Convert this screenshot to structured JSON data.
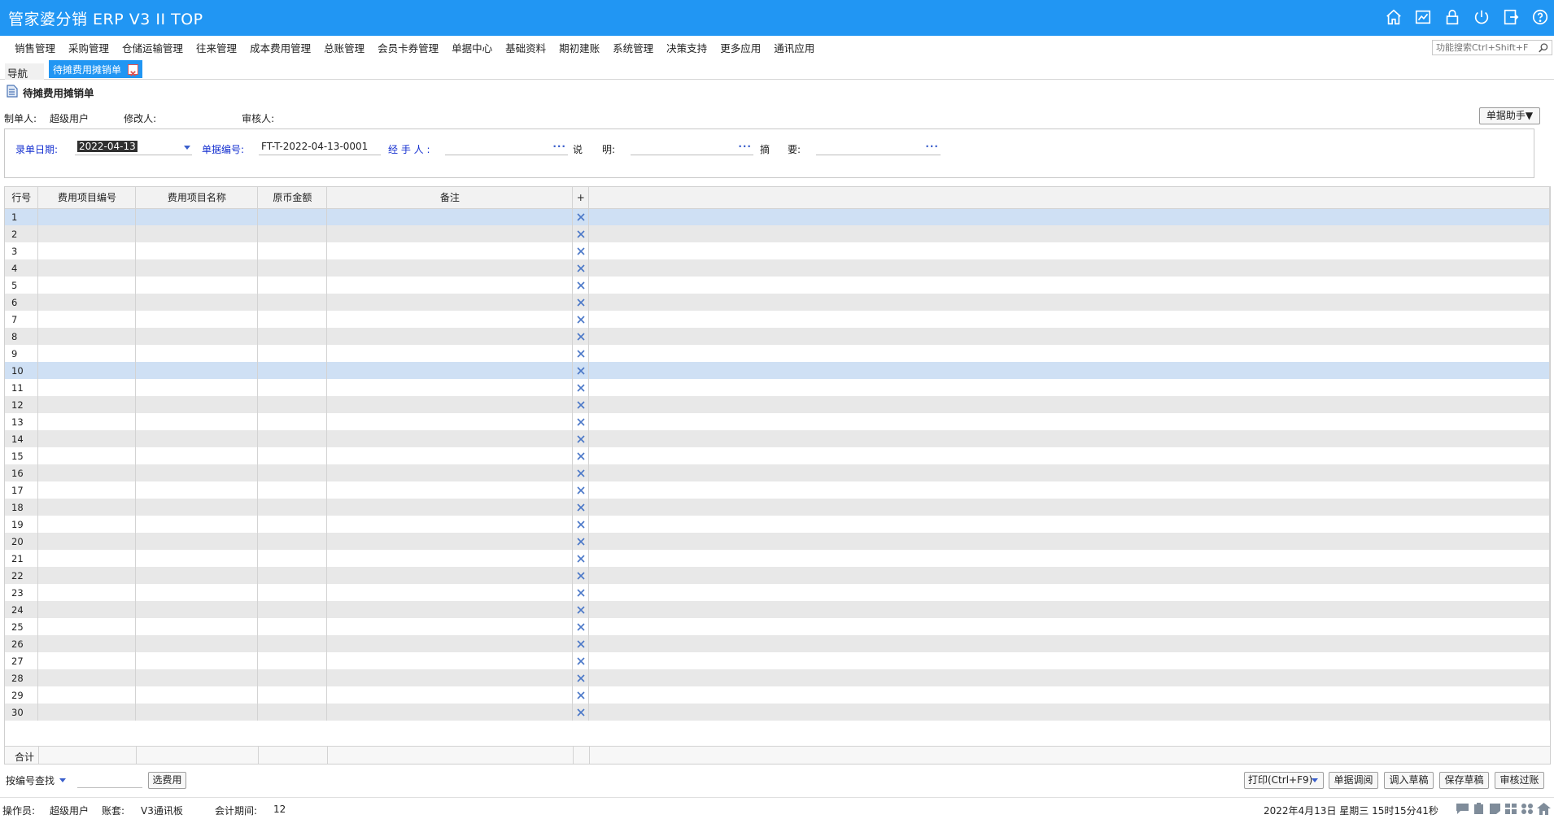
{
  "app": {
    "title": "管家婆分销 ERP V3 II TOP"
  },
  "header_icons": [
    "home-icon",
    "chart-icon",
    "lock-icon",
    "power-icon",
    "logout-icon",
    "help-icon"
  ],
  "menu": {
    "items": [
      "销售管理",
      "采购管理",
      "仓储运输管理",
      "往来管理",
      "成本费用管理",
      "总账管理",
      "会员卡券管理",
      "单据中心",
      "基础资料",
      "期初建账",
      "系统管理",
      "决策支持",
      "更多应用",
      "通讯应用"
    ],
    "search_placeholder": "功能搜索Ctrl+Shift+F"
  },
  "tabs": {
    "nav": "导航",
    "active": "待摊费用摊销单"
  },
  "page": {
    "title": "待摊费用摊销单",
    "maker_label": "制单人:",
    "maker_value": "超级用户",
    "modifier_label": "修改人:",
    "reviewer_label": "审核人:",
    "assistant_button": "单据助手▼"
  },
  "form": {
    "date_label": "录单日期:",
    "date_value": "2022-04-13",
    "billno_label": "单据编号:",
    "billno_value": "FT-T-2022-04-13-0001",
    "handler_label": "经 手 人 :",
    "desc_label_a": "说",
    "desc_label_b": "明:",
    "summary_label_a": "摘",
    "summary_label_b": "要:",
    "dots": "···"
  },
  "grid": {
    "columns": [
      "行号",
      "费用项目编号",
      "费用项目名称",
      "原币金额",
      "备注",
      "+"
    ],
    "rows": [
      "1",
      "2",
      "3",
      "4",
      "5",
      "6",
      "7",
      "8",
      "9",
      "10",
      "11",
      "12",
      "13",
      "14",
      "15",
      "16",
      "17",
      "18",
      "19",
      "20",
      "21",
      "22",
      "23",
      "24",
      "25",
      "26",
      "27",
      "28",
      "29",
      "30"
    ],
    "selected_rows": [
      1,
      10
    ],
    "total_label": "合计"
  },
  "toolbar": {
    "search_mode": "按编号查找",
    "select_expense": "选费用",
    "print": "打印(Ctrl+F9)",
    "bill_call": "单据调阅",
    "load_draft": "调入草稿",
    "save_draft": "保存草稿",
    "review_post": "审核过账"
  },
  "status": {
    "operator_label": "操作员:",
    "operator_value": "超级用户",
    "account_label": "账套:",
    "account_value": "V3通讯板",
    "period_label": "会计期间:",
    "period_value": "12",
    "datetime": "2022年4月13日  星期三  15时15分41秒"
  },
  "colors": {
    "accent": "#2196f3",
    "selected_row": "#cfe0f4",
    "label_blue": "#1530d0"
  }
}
